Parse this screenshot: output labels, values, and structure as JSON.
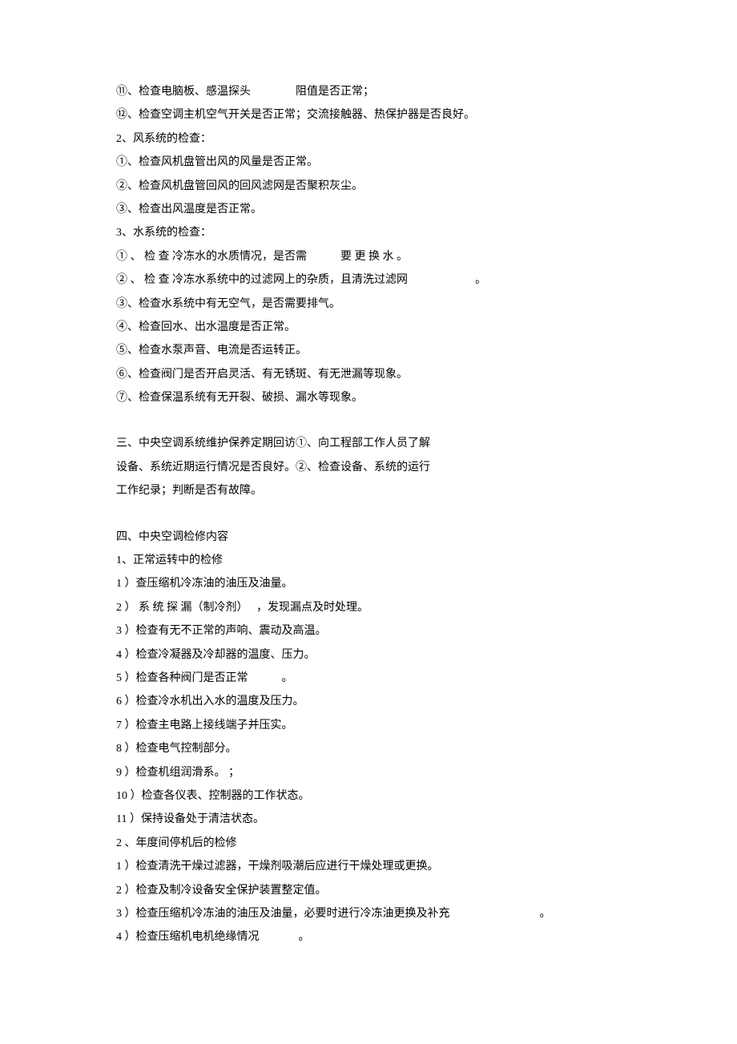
{
  "lines": [
    "⑪、检查电脑板、感温探头                阻值是否正常；",
    "⑫、检查空调主机空气开关是否正常；交流接触器、热保护器是否良好。",
    "2、风系统的检查：",
    "①、检查风机盘管出风的风量是否正常。",
    "②、检查风机盘管回风的回风滤网是否聚积灰尘。",
    "③、检查出风温度是否正常。",
    "3、水系统的检查：",
    "① 、 检 查 冷冻水的水质情况，是否需            要 更 换 水 。",
    "② 、 检 查 冷冻水系统中的过滤网上的杂质，且清洗过滤网                        。",
    "③、检查水系统中有无空气，是否需要排气。",
    "④、检查回水、出水温度是否正常。",
    "⑤、检查水泵声音、电流是否运转正。",
    "⑥、检查阀门是否开启灵活、有无锈斑、有无泄漏等现象。",
    "⑦、检查保温系统有无开裂、破损、漏水等现象。"
  ],
  "section3": [
    "三、中央空调系统维护保养定期回访①、向工程部工作人员了解",
    "设备、系统近期运行情况是否良好。②、检查设备、系统的运行",
    "工作纪录；判断是否有故障。"
  ],
  "section4": [
    "四、中央空调检修内容",
    "1、正常运转中的检修",
    "1 ）查压缩机冷冻油的油压及油量。",
    "2 ） 系 统 探 漏（制冷剂）   ，发现漏点及时处理。",
    "3 ）检查有无不正常的声响、震动及高温。",
    "4 ）检查冷凝器及冷却器的温度、压力。",
    "5 ）检查各种阀门是否正常            。",
    "6 ）检查冷水机出入水的温度及压力。",
    "7 ）检查主电路上接线端子并压实。",
    "8 ）检查电气控制部分。",
    "9 ）检查机组润滑系。 ；",
    "10 ）检查各仪表、控制器的工作状态。",
    "11 ）保持设备处于清洁状态。",
    "2 、年度间停机后的检修",
    "1 ）检查清洗干燥过滤器，干燥剂吸潮后应进行干燥处理或更换。",
    "2 ）检查及制冷设备安全保护装置整定值。",
    "3 ）检查压缩机冷冻油的油压及油量，必要时进行冷冻油更换及补充                                。",
    "4 ）检查压缩机电机绝缘情况              。"
  ]
}
